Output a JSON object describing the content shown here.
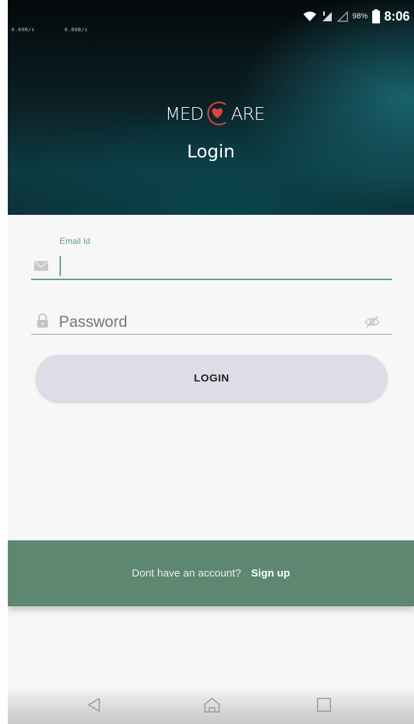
{
  "status_bar": {
    "net_speed_left": "0.00B/s",
    "net_speed_right": "0.00B/s",
    "battery_percent": "98%",
    "time": "8:06",
    "icons": [
      "wifi-icon",
      "signal-icon",
      "signal-icon-2",
      "battery-icon"
    ]
  },
  "header": {
    "logo_left": "MED",
    "logo_right": "ARE",
    "title": "Login"
  },
  "form": {
    "email_label": "Email Id",
    "email_value": "",
    "password_placeholder": "Password",
    "password_value": "",
    "login_label": "LOGIN",
    "icons": [
      "email-icon",
      "lock-icon",
      "visibility-off-icon"
    ]
  },
  "footer": {
    "question": "Dont have an account?",
    "signup_label": "Sign up"
  },
  "nav": {
    "icons": [
      "back-icon",
      "home-icon",
      "recents-icon"
    ]
  },
  "colors": {
    "accent_green": "#5aa37b",
    "footer_green": "#5e8772",
    "button_bg": "#dcdde6",
    "header_dark": "#0c3036",
    "logo_heart": "#e0413f"
  }
}
